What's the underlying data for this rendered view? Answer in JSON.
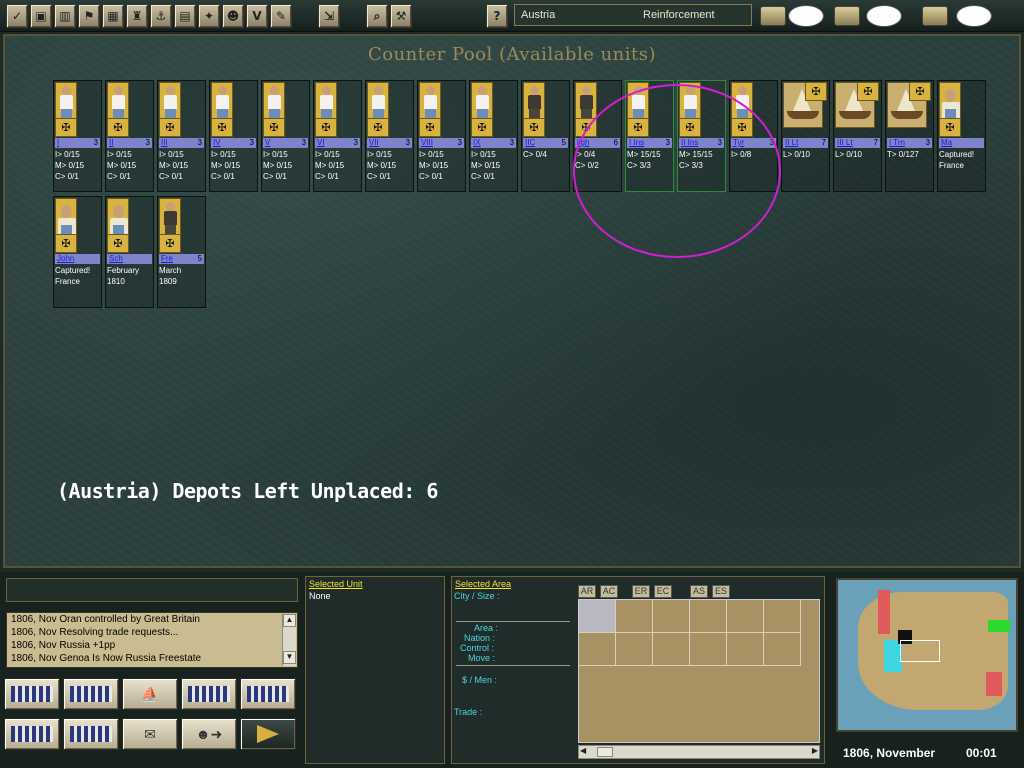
{
  "toolbar": {
    "nation": "Austria",
    "phase": "Reinforcement",
    "help_label": "?",
    "icons": [
      "end-phase-icon",
      "ledger-icon",
      "chart-icon",
      "diplomacy-icon",
      "trade-icon",
      "land-icon",
      "naval-icon",
      "report-icon",
      "map-icon",
      "leader-icon",
      "victory-icon",
      "options-icon",
      "export-icon",
      "zoom-icon",
      "tools-icon"
    ]
  },
  "pool": {
    "title": "Counter Pool (Available units)",
    "depots_text": "(Austria) Depots Left Unplaced: 6",
    "units": [
      {
        "name": "I",
        "str": "3",
        "stats": "I> 0/15\nM> 0/15\nC> 0/1",
        "type": "inf"
      },
      {
        "name": "II",
        "str": "3",
        "stats": "I> 0/15\nM> 0/15\nC> 0/1",
        "type": "inf"
      },
      {
        "name": "III",
        "str": "3",
        "stats": "I> 0/15\nM> 0/15\nC> 0/1",
        "type": "inf"
      },
      {
        "name": "IV",
        "str": "3",
        "stats": "I> 0/15\nM> 0/15\nC> 0/1",
        "type": "inf"
      },
      {
        "name": "V",
        "str": "3",
        "stats": "I> 0/15\nM> 0/15\nC> 0/1",
        "type": "inf"
      },
      {
        "name": "VI",
        "str": "3",
        "stats": "I> 0/15\nM> 0/15\nC> 0/1",
        "type": "inf"
      },
      {
        "name": "VII",
        "str": "3",
        "stats": "I> 0/15\nM> 0/15\nC> 0/1",
        "type": "inf"
      },
      {
        "name": "VIII",
        "str": "3",
        "stats": "I> 0/15\nM> 0/15\nC> 0/1",
        "type": "inf"
      },
      {
        "name": "IX",
        "str": "3",
        "stats": "I> 0/15\nM> 0/15\nC> 0/1",
        "type": "inf"
      },
      {
        "name": "IIC",
        "str": "5",
        "stats": "C> 0/4",
        "type": "general"
      },
      {
        "name": "ligh",
        "str": "6",
        "stats": "I> 0/4\nC> 0/2",
        "type": "general"
      },
      {
        "name": "I Ins",
        "str": "3",
        "stats": "M> 15/15\nC> 3/3",
        "type": "inf",
        "selected": true
      },
      {
        "name": "II Ins",
        "str": "3",
        "stats": "M> 15/15\nC> 3/3",
        "type": "inf",
        "selected": true
      },
      {
        "name": "Tyr",
        "str": "3",
        "stats": "I> 0/8",
        "type": "inf"
      },
      {
        "name": "II Lt",
        "str": "7",
        "stats": "L> 0/10",
        "type": "ship"
      },
      {
        "name": "III Lt",
        "str": "7",
        "stats": "L> 0/10",
        "type": "ship"
      },
      {
        "name": "I Trn",
        "str": "3",
        "stats": "T> 0/127",
        "type": "ship"
      },
      {
        "name": "Ma",
        "str": "",
        "stats": "Captured!\nFrance",
        "type": "bust"
      },
      {
        "name": "John",
        "str": "",
        "stats": "Captured!\nFrance",
        "type": "bust"
      },
      {
        "name": "Sch",
        "str": "",
        "stats": "February\n1810",
        "type": "bust"
      },
      {
        "name": "Fre",
        "str": "5",
        "stats": "March\n1809",
        "type": "general"
      }
    ]
  },
  "log": {
    "lines": [
      "1806, Nov Oran controlled by Great Britain",
      "1806, Nov Resolving trade requests...",
      "1806, Nov Russia +1pp",
      "1806, Nov Genoa Is Now Russia Freestate"
    ]
  },
  "commands": [
    "build-infantry",
    "build-depot",
    "build-fleet",
    "disband",
    "build-cavalry",
    "build-barracks",
    "appoint-leader",
    "scroll-orders",
    "diplomat",
    "next-phase"
  ],
  "unit_panel": {
    "label": "Selected Unit",
    "value": "None"
  },
  "area_panel": {
    "label": "Selected Area",
    "city_size": "City / Size :",
    "area": "Area :",
    "nation": "Nation :",
    "control": "Control :",
    "move": "Move :",
    "money_men": "$ / Men :",
    "trade": "Trade :",
    "tabs": [
      "AR",
      "AC",
      "ER",
      "EC",
      "AS",
      "ES"
    ]
  },
  "status": {
    "date": "1806, November",
    "clock": "00:01"
  },
  "colors": {
    "highlight": "#d21ed2",
    "selected_border": "#2e8a3a",
    "panel_label": "#f6e62a",
    "area_label": "#4fd6e0"
  }
}
